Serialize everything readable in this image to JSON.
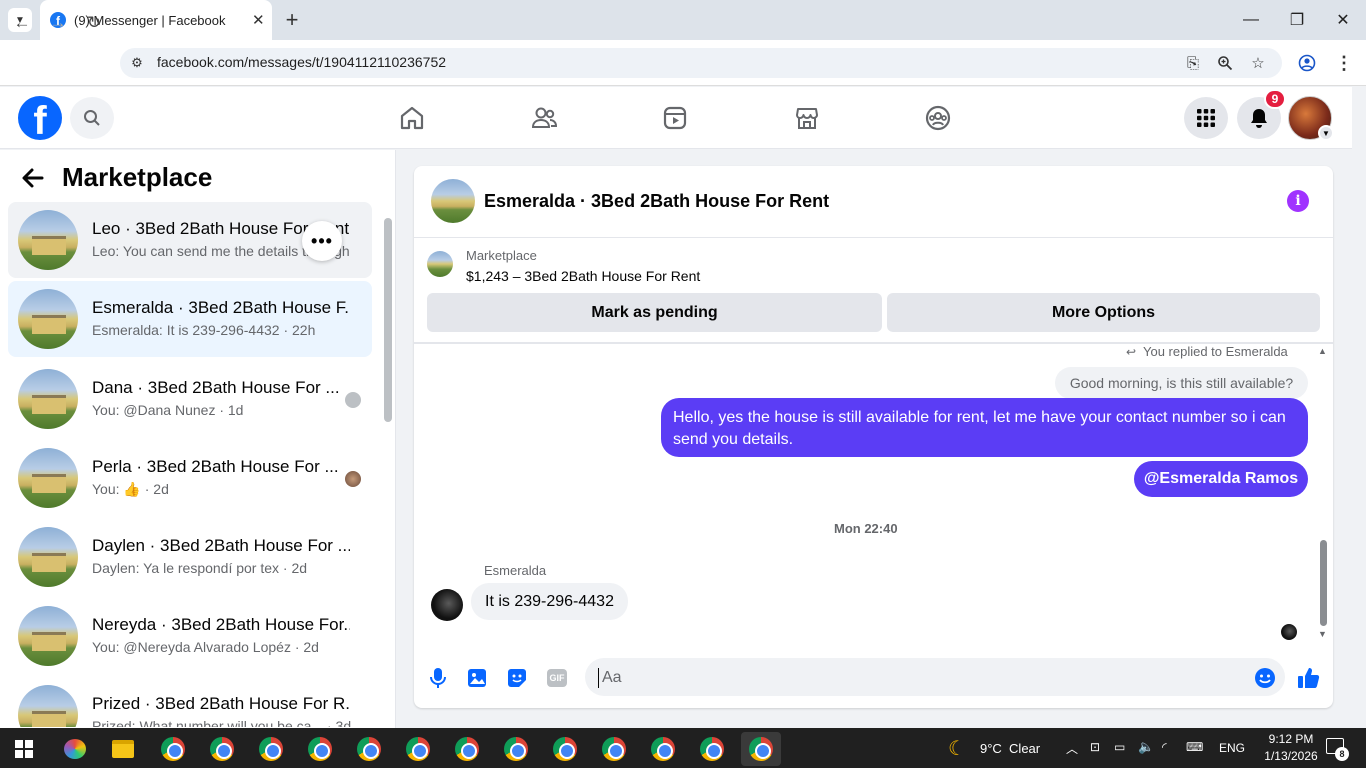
{
  "browser": {
    "tab_title": "(9) Messenger | Facebook",
    "tab_close": "✕",
    "new_tab": "+",
    "url": "facebook.com/messages/t/1904112110236752"
  },
  "fb": {
    "notification_count": "9"
  },
  "sidebar": {
    "title": "Marketplace",
    "conversations": [
      {
        "name": "Leo · 3Bed 2Bath House For Rent",
        "preview": "Leo: You can send me the details through",
        "active": false,
        "hovered": true
      },
      {
        "name": "Esmeralda · 3Bed 2Bath House F...",
        "preview": "Esmeralda: It is 239-296-4432 · 22h",
        "active": true
      },
      {
        "name": "Dana · 3Bed 2Bath House For ...",
        "preview": "You: @Dana Nunez · 1d",
        "active": false
      },
      {
        "name": "Perla · 3Bed 2Bath House For ...",
        "preview": "You: 👍 · 2d",
        "active": false
      },
      {
        "name": "Daylen · 3Bed 2Bath House For ...",
        "preview": "Daylen: Ya le respondí por tex · 2d",
        "active": false
      },
      {
        "name": "Nereyda · 3Bed 2Bath House For...",
        "preview": "You: @Nereyda Alvarado Lopéz · 2d",
        "active": false
      },
      {
        "name": "Prized · 3Bed 2Bath House For R...",
        "preview": "Prized: What number will you be ca... · 3d",
        "active": false
      }
    ]
  },
  "chat": {
    "title": "Esmeralda · 3Bed 2Bath House For Rent",
    "info_icon": "i",
    "marketplace_label": "Marketplace",
    "listing": "$1,243 – 3Bed 2Bath House For Rent",
    "mark_pending": "Mark as pending",
    "more_options": "More Options",
    "replied_to": "You replied to Esmeralda",
    "quoted_message": "Good morning, is this still available?",
    "sent_message": "Hello, yes the house is still available for rent, let me have your contact number so i can send you details.",
    "mention": "@Esmeralda Ramos",
    "timestamp": "Mon 22:40",
    "sender_name": "Esmeralda",
    "received_message": "It is 239-296-4432",
    "composer_placeholder": "Aa"
  },
  "taskbar": {
    "weather": "9°C  Clear",
    "language": "ENG",
    "time": "9:12 PM",
    "date": "1/13/2026",
    "notifications": "8"
  },
  "colors": {
    "accent": "#5b3df5",
    "fb_blue": "#0866ff",
    "info_purple": "#a033ff"
  }
}
